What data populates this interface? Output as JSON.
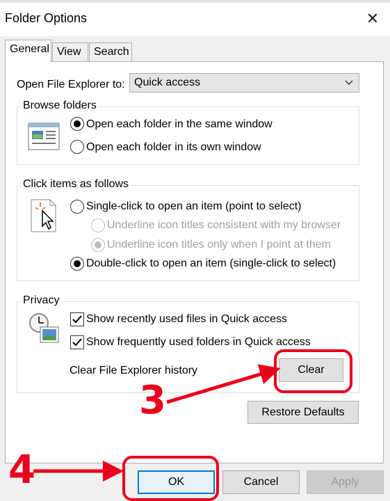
{
  "window": {
    "title": "Folder Options",
    "close_glyph": "✕"
  },
  "tabs": [
    {
      "label": "General",
      "active": true
    },
    {
      "label": "View",
      "active": false
    },
    {
      "label": "Search",
      "active": false
    }
  ],
  "general": {
    "open_to_label": "Open File Explorer to:",
    "open_to_value": "Quick access",
    "browse_folders": {
      "title": "Browse folders",
      "icon": "folder-window-icon",
      "options": [
        {
          "label": "Open each folder in the same window",
          "checked": true
        },
        {
          "label": "Open each folder in its own window",
          "checked": false
        }
      ]
    },
    "click_items": {
      "title": "Click items as follows",
      "icon": "pointer-click-icon",
      "single": {
        "label": "Single-click to open an item (point to select)",
        "checked": false
      },
      "underline_browser": {
        "label": "Underline icon titles consistent with my browser",
        "checked": false,
        "disabled": true
      },
      "underline_point": {
        "label": "Underline icon titles only when I point at them",
        "checked": true,
        "disabled": true
      },
      "double": {
        "label": "Double-click to open an item (single-click to select)",
        "checked": true
      }
    },
    "privacy": {
      "title": "Privacy",
      "icon": "clock-privacy-icon",
      "recent_files": {
        "label": "Show recently used files in Quick access",
        "checked": true
      },
      "frequent_folders": {
        "label": "Show frequently used folders in Quick access",
        "checked": true
      },
      "clear_history_label": "Clear File Explorer history",
      "clear_button": "Clear"
    },
    "restore_defaults": "Restore Defaults"
  },
  "footer": {
    "ok": "OK",
    "cancel": "Cancel",
    "apply": "Apply"
  },
  "annotations": {
    "step3": "3",
    "step4": "4",
    "color": "#e8001c"
  },
  "colors": {
    "accent": "#0078d7",
    "annotation_red": "#e8001c"
  }
}
